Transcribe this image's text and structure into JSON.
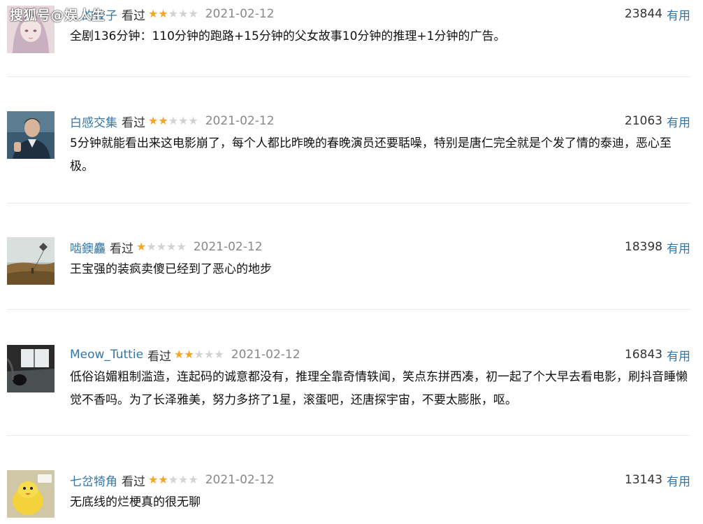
{
  "watermark": "搜狐号@娱人生",
  "watched_label": "看过",
  "useful_label": "有用",
  "colors": {
    "link": "#3377aa",
    "star_on": "#f5a623",
    "star_off": "#d3d3d3",
    "date": "#888888"
  },
  "comments": [
    {
      "user": "…的饺子",
      "rating": 2,
      "date": "2021-02-12",
      "votes": "23844",
      "text": "全剧136分钟：110分钟的跑路+15分钟的父女故事10分钟的推理+1分钟的广告。",
      "avatar": "anime-girl"
    },
    {
      "user": "白感交集",
      "rating": 2,
      "date": "2021-02-12",
      "votes": "21063",
      "text": "5分钟就能看出来这电影崩了，每个人都比昨晚的春晚演员还要聒噪，特别是唐仁完全就是个发了情的泰迪，恶心至极。",
      "avatar": "man-portrait"
    },
    {
      "user": "啮鐭麤",
      "rating": 1,
      "date": "2021-02-12",
      "votes": "18398",
      "text": "王宝强的装疯卖傻已经到了恶心的地步",
      "avatar": "kite-field"
    },
    {
      "user": "Meow_Tuttie",
      "rating": 2,
      "date": "2021-02-12",
      "votes": "16843",
      "text": "低俗谄媚粗制滥造，连起码的诚意都没有，推理全靠奇情轶闻，笑点东拼西凑，初一起了个大早去看电影，刷抖音睡懒觉不香吗。为了长泽雅美，努力多挤了1星，滚蛋吧，还唐探宇宙，不要太膨胀，呕。",
      "avatar": "dark-room"
    },
    {
      "user": "七岔犄角",
      "rating": 2,
      "date": "2021-02-12",
      "votes": "13143",
      "text": "无底线的烂梗真的很无聊",
      "avatar": "yellow-duck"
    }
  ]
}
